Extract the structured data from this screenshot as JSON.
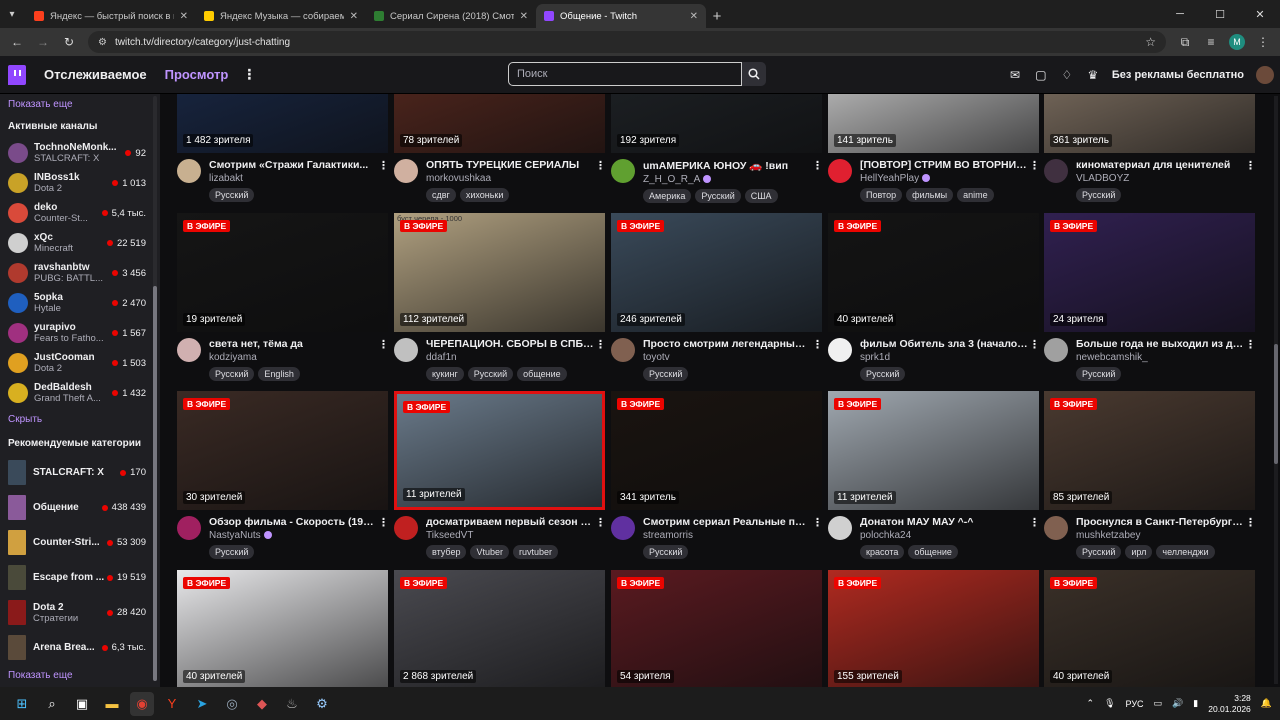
{
  "browser": {
    "tabs": [
      {
        "title": "Яндекс — быстрый поиск в ин",
        "color": "#fc3f1d"
      },
      {
        "title": "Яндекс Музыка — собираем м",
        "color": "#ffcc00"
      },
      {
        "title": "Сериал Сирена (2018) Смотре",
        "color": "#2e7d32"
      },
      {
        "title": "Общение - Twitch",
        "color": "#9147ff",
        "active": true
      }
    ],
    "url": "twitch.tv/directory/category/just-chatting",
    "profile_initial": "M"
  },
  "twitch_nav": {
    "following": "Отслеживаемое",
    "browse": "Просмотр",
    "search_placeholder": "Поиск",
    "turbo": "Без рекламы бесплатно"
  },
  "sidebar": {
    "show_more_top": "Показать еще",
    "active_header": "Активные каналы",
    "channels": [
      {
        "name": "TochnoNeMonk...",
        "game": "STALCRAFT: X",
        "viewers": "92",
        "color": "#7a4b8a"
      },
      {
        "name": "INBoss1k",
        "game": "Dota 2",
        "viewers": "1 013",
        "color": "#c9a227"
      },
      {
        "name": "deko",
        "game": "Counter-St...",
        "viewers": "5,4 тыс.",
        "color": "#d94a3a"
      },
      {
        "name": "xQc",
        "game": "Minecraft",
        "viewers": "22 519",
        "color": "#cfcfcf"
      },
      {
        "name": "ravshanbtw",
        "game": "PUBG: BATTL...",
        "viewers": "3 456",
        "color": "#b03a2e"
      },
      {
        "name": "5opka",
        "game": "Hytale",
        "viewers": "2 470",
        "color": "#1f5fbf"
      },
      {
        "name": "yurapivo",
        "game": "Fears to Fatho...",
        "viewers": "1 567",
        "color": "#a03080"
      },
      {
        "name": "JustCooman",
        "game": "Dota 2",
        "viewers": "1 503",
        "color": "#e0a020"
      },
      {
        "name": "DedBaldesh",
        "game": "Grand Theft A...",
        "viewers": "1 432",
        "color": "#d8b020"
      }
    ],
    "hide": "Скрыть",
    "rec_header": "Рекомендуемые категории",
    "categories": [
      {
        "name": "STALCRAFT: X",
        "sub": "",
        "viewers": "170",
        "color": "#3a4a5a"
      },
      {
        "name": "Общение",
        "sub": "",
        "viewers": "438 439",
        "color": "#8a5a9a"
      },
      {
        "name": "Counter-Stri...",
        "sub": "",
        "viewers": "53 309",
        "color": "#d0a040"
      },
      {
        "name": "Escape from ...",
        "sub": "",
        "viewers": "19 519",
        "color": "#4a4a3a"
      },
      {
        "name": "Dota 2",
        "sub": "Стратегии",
        "viewers": "28 420",
        "color": "#8a1a1a"
      },
      {
        "name": "Arena Brea...",
        "sub": "",
        "viewers": "6,3 тыс.",
        "color": "#5a4a3a"
      }
    ],
    "show_more_bottom": "Показать еще"
  },
  "live_label": "В ЭФИРЕ",
  "streams": [
    {
      "viewers": "1 482 зрителя",
      "title": "Смотрим «Стражи Галактики...",
      "channel": "lizabakt",
      "tags": [
        "Русский"
      ],
      "thumb": "#1a2a4a",
      "avatar": "#c8b090",
      "live": false
    },
    {
      "viewers": "78 зрителей",
      "title": "ОПЯТЬ ТУРЕЦКИЕ СЕРИАЛЫ",
      "channel": "morkovushkaa",
      "tags": [
        "сдвг",
        "хихоньки"
      ],
      "thumb": "#5a2a20",
      "avatar": "#d0b0a0",
      "live": false
    },
    {
      "viewers": "192 зрителя",
      "title": "umАМЕРИКА ЮНОУ 🚗 !вип",
      "channel": "Z_H_O_R_A",
      "tags": [
        "Америка",
        "Русский",
        "США"
      ],
      "thumb": "#202428",
      "avatar": "#60a030",
      "live": false,
      "verified": true
    },
    {
      "viewers": "141 зритель",
      "title": "[ПОВТОР] СТРИМ ВО ВТОРНИК, ...",
      "channel": "HellYeahPlay",
      "tags": [
        "Повтор",
        "фильмы",
        "anime"
      ],
      "thumb": "#d8d8d8",
      "avatar": "#e02030",
      "live": false,
      "verified": true
    },
    {
      "viewers": "361 зритель",
      "title": "киноматериал для ценителей",
      "channel": "VLADBOYZ",
      "tags": [
        "Русский"
      ],
      "thumb": "#8a7a6a",
      "avatar": "#403040",
      "live": false
    },
    {
      "viewers": "19 зрителей",
      "title": "света нет, тёма да",
      "channel": "kodziyama",
      "tags": [
        "Русский",
        "English"
      ],
      "thumb": "#151515",
      "avatar": "#d0b0b0",
      "live": true
    },
    {
      "viewers": "112 зрителей",
      "title": "ЧЕРЕПАЦИОН. СБОРЫ В СПБ. | !...",
      "channel": "ddaf1n",
      "tags": [
        "кукинг",
        "Русский",
        "общение"
      ],
      "thumb": "#b0a080",
      "avatar": "#c0c0c0",
      "live": true,
      "overlay": "буст черепа - 1000"
    },
    {
      "viewers": "246 зрителей",
      "title": "Просто смотрим легендарный ф...",
      "channel": "toyotv",
      "tags": [
        "Русский"
      ],
      "thumb": "#3a4a5a",
      "avatar": "#806050",
      "live": true
    },
    {
      "viewers": "40 зрителей",
      "title": "фильм Обитель зла 3 (начало 3:1...",
      "channel": "sprk1d",
      "tags": [
        "Русский"
      ],
      "thumb": "#141414",
      "avatar": "#f0f0f0",
      "live": true
    },
    {
      "viewers": "24 зрителя",
      "title": "Больше года не выходил из дом...",
      "channel": "newebcamshik_",
      "tags": [
        "Русский"
      ],
      "thumb": "#302050",
      "avatar": "#a0a0a0",
      "live": true
    },
    {
      "viewers": "30 зрителей",
      "title": "Обзор фильма - Скорость (1994)...",
      "channel": "NastyaNuts",
      "tags": [
        "Русский"
      ],
      "thumb": "#3a2a24",
      "avatar": "#a02060",
      "live": true,
      "verified": true
    },
    {
      "viewers": "11 зрителей",
      "title": "досматриваем первый сезон \"8...",
      "channel": "TikseedVT",
      "tags": [
        "втубер",
        "Vtuber",
        "ruvtuber"
      ],
      "thumb": "#6a7a8a",
      "avatar": "#c02020",
      "live": true,
      "border": "#e01010"
    },
    {
      "viewers": "341 зритель",
      "title": "Смотрим сериал Реальные паца...",
      "channel": "streamorris",
      "tags": [
        "Русский"
      ],
      "thumb": "#1a1410",
      "avatar": "#6030a0",
      "live": true
    },
    {
      "viewers": "11 зрителей",
      "title": "Донатон МАУ МАУ ^-^",
      "channel": "polochka24",
      "tags": [
        "красота",
        "общение"
      ],
      "thumb": "#a0a8b0",
      "avatar": "#d0d0d0",
      "live": true
    },
    {
      "viewers": "85 зрителей",
      "title": "Проснулся в Санкт-Петербурге. ...",
      "channel": "mushketzabey",
      "tags": [
        "Русский",
        "ирл",
        "челленджи"
      ],
      "thumb": "#4a3a30",
      "avatar": "#806050",
      "live": true
    },
    {
      "viewers": "40 зрителей",
      "title": "",
      "channel": "",
      "tags": [],
      "thumb": "#e8e8ea",
      "avatar": "#888",
      "live": true
    },
    {
      "viewers": "2 868 зрителей",
      "title": "",
      "channel": "",
      "tags": [],
      "thumb": "#4a4a50",
      "avatar": "#888",
      "live": true
    },
    {
      "viewers": "54 зрителя",
      "title": "",
      "channel": "",
      "tags": [],
      "thumb": "#5a1a20",
      "avatar": "#888",
      "live": true
    },
    {
      "viewers": "155 зрителей",
      "title": "",
      "channel": "",
      "tags": [],
      "thumb": "#b02a20",
      "avatar": "#888",
      "live": true
    },
    {
      "viewers": "40 зрителей",
      "title": "",
      "channel": "",
      "tags": [],
      "thumb": "#3a3028",
      "avatar": "#888",
      "live": true
    }
  ],
  "taskbar": {
    "lang": "РУС",
    "time": "3:28",
    "date": "20.01.2026"
  }
}
